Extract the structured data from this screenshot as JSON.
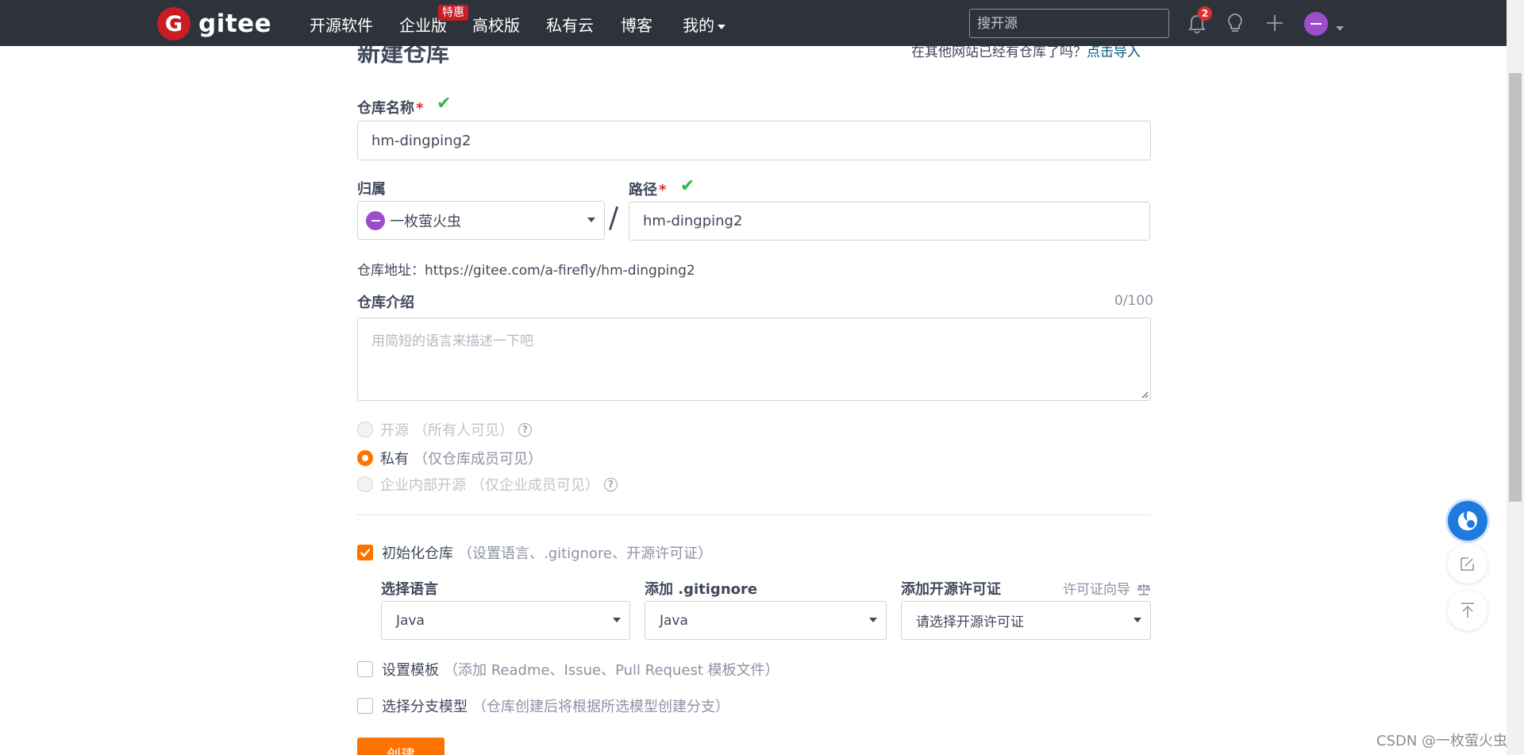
{
  "nav": {
    "brand": "gitee",
    "logo_letter": "G",
    "items": [
      "开源软件",
      "企业版",
      "高校版",
      "私有云",
      "博客",
      "我的"
    ],
    "enterprise_badge": "特惠",
    "search_placeholder": "搜开源",
    "notification_count": "2"
  },
  "page": {
    "title": "新建仓库",
    "import_hint": "在其他网站已经有仓库了吗？",
    "import_link": "点击导入"
  },
  "form": {
    "name_label": "仓库名称",
    "name_value": "hm-dingping2",
    "owner_label": "归属",
    "owner_value": "一枚萤火虫",
    "separator": "/",
    "path_label": "路径",
    "path_value": "hm-dingping2",
    "url_prefix": "仓库地址：",
    "url_value": "https://gitee.com/a-firefly/hm-dingping2",
    "desc_label": "仓库介绍",
    "desc_counter": "0/100",
    "desc_placeholder": "用简短的语言来描述一下吧",
    "required_mark": "*",
    "help_mark": "?",
    "visibility": [
      {
        "label": "开源",
        "hint": "（所有人可见）",
        "selected": false,
        "disabled": true
      },
      {
        "label": "私有",
        "hint": "（仅仓库成员可见）",
        "selected": true,
        "disabled": false
      },
      {
        "label": "企业内部开源",
        "hint": "（仅企业成员可见）",
        "selected": false,
        "disabled": true
      }
    ],
    "init": {
      "label": "初始化仓库",
      "hint": "（设置语言、.gitignore、开源许可证）",
      "checked": true
    },
    "language_label": "选择语言",
    "language_value": "Java",
    "gitignore_label": "添加 .gitignore",
    "gitignore_value": "Java",
    "license_label": "添加开源许可证",
    "license_guide": "许可证向导",
    "license_value": "请选择开源许可证",
    "template": {
      "label": "设置模板",
      "hint": "（添加 Readme、Issue、Pull Request 模板文件）",
      "checked": false
    },
    "branch": {
      "label": "选择分支模型",
      "hint": "（仓库创建后将根据所选模型创建分支）",
      "checked": false
    },
    "submit_label": "创建"
  },
  "watermark": "CSDN @一枚萤火虫",
  "colors": {
    "nav_bg": "#2e323b",
    "brand_red": "#c71d23",
    "accent_orange": "#fe7300",
    "success_green": "#2db84d",
    "link_blue": "#005980",
    "avatar_purple": "#9b4dca"
  }
}
